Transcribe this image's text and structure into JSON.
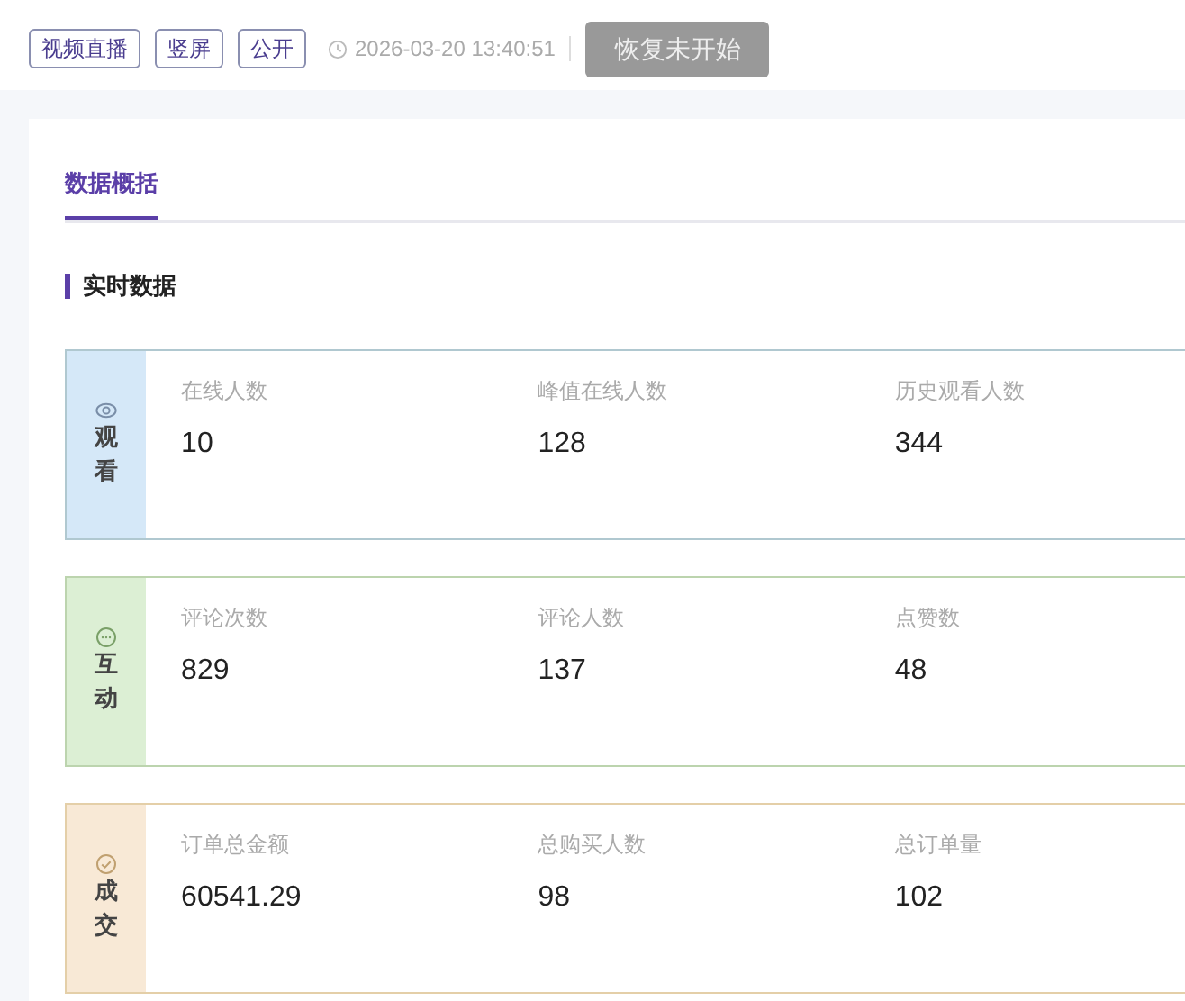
{
  "header": {
    "tags": [
      "视频直播",
      "竖屏",
      "公开"
    ],
    "time": "2026-03-20 13:40:51",
    "action_button": {
      "label": "恢复未开始",
      "disabled": true
    }
  },
  "tabs": [
    {
      "label": "数据概括",
      "selected": true
    }
  ],
  "section_title": "实时数据",
  "groups": [
    {
      "kind": "watch",
      "label": "观看",
      "color": "#d5e8f8",
      "metrics": [
        {
          "label": "在线人数",
          "value": "10"
        },
        {
          "label": "峰值在线人数",
          "value": "128"
        },
        {
          "label": "历史观看人数",
          "value": "344"
        }
      ]
    },
    {
      "kind": "interact",
      "label": "互动",
      "color": "#dcefd4",
      "metrics": [
        {
          "label": "评论次数",
          "value": "829"
        },
        {
          "label": "评论人数",
          "value": "137"
        },
        {
          "label": "点赞数",
          "value": "48"
        }
      ]
    },
    {
      "kind": "deal",
      "label": "成交",
      "color": "#f8e9d6",
      "metrics": [
        {
          "label": "订单总金额",
          "value": "60541.29"
        },
        {
          "label": "总购买人数",
          "value": "98"
        },
        {
          "label": "总订单量",
          "value": "102"
        }
      ]
    }
  ]
}
